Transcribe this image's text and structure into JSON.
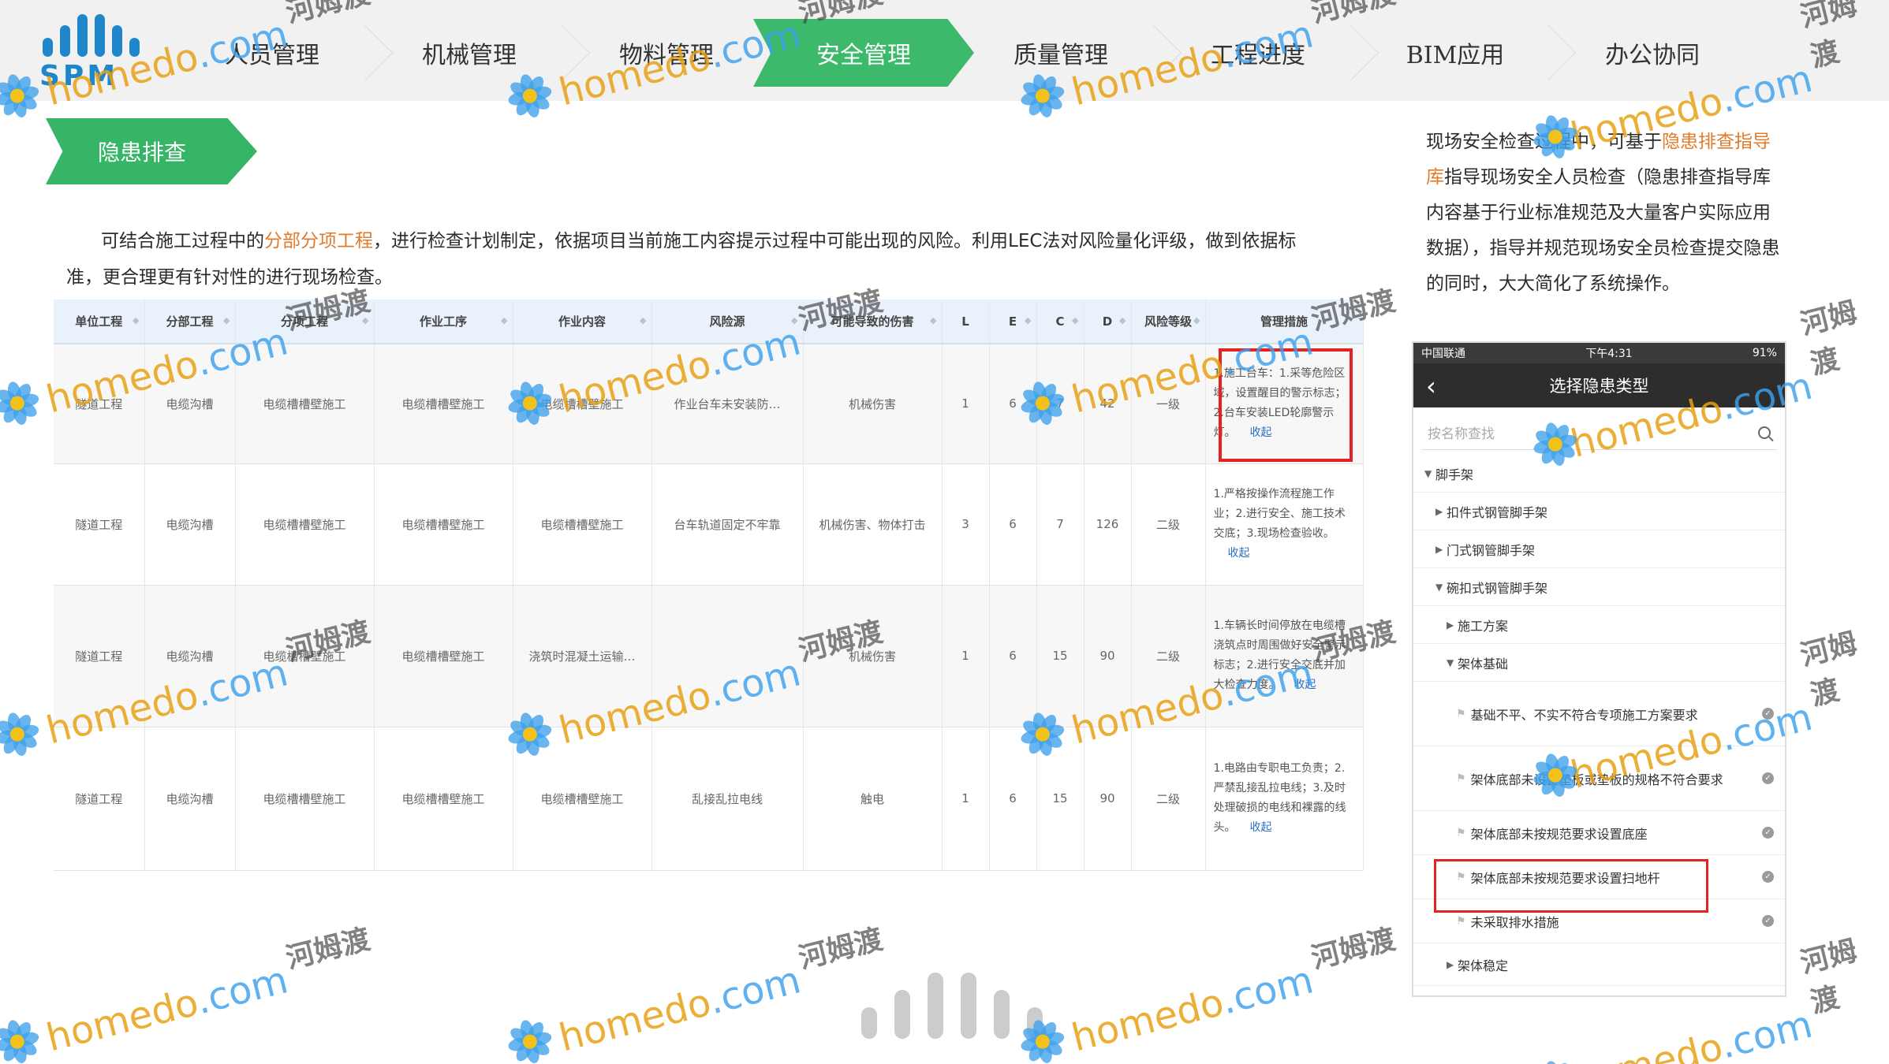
{
  "brand": {
    "logo_text": "SPM"
  },
  "nav": {
    "items": [
      {
        "label": "人员管理",
        "active": false
      },
      {
        "label": "机械管理",
        "active": false
      },
      {
        "label": "物料管理",
        "active": false
      },
      {
        "label": "安全管理",
        "active": true
      },
      {
        "label": "质量管理",
        "active": false
      },
      {
        "label": "工程进度",
        "active": false
      },
      {
        "label": "BIM应用",
        "active": false
      },
      {
        "label": "办公协同",
        "active": false
      }
    ],
    "active_color": "#3cb96a"
  },
  "section": {
    "title": "隐患排查"
  },
  "description": {
    "part1": "可结合施工过程中的",
    "highlight": "分部分项工程",
    "part2": "，进行检查计划制定，依据项目当前施工内容提示过程中可能出现的风险。利用LEC法对风险量化评级，做到依据标准，更合理更有针对性的进行现场检查。"
  },
  "table": {
    "columns": [
      "单位工程",
      "分部工程",
      "分项工程",
      "作业工序",
      "作业内容",
      "风险源",
      "可能导致的伤害",
      "L",
      "E",
      "C",
      "D",
      "风险等级",
      "管理措施"
    ],
    "collapse_label": "收起",
    "rows": [
      {
        "unit": "隧道工程",
        "part": "电缆沟槽",
        "item": "电缆槽槽壁施工",
        "process": "电缆槽槽壁施工",
        "content": "电缆槽槽壁施工",
        "risk": "作业台车未安装防…",
        "harm": "机械伤害",
        "L": "1",
        "E": "6",
        "C": "7",
        "D": "42",
        "level": "一级",
        "measure": "1.施工台车：1.采等危险区域，设置醒目的警示标志；2.台车安装LED轮廓警示灯。"
      },
      {
        "unit": "隧道工程",
        "part": "电缆沟槽",
        "item": "电缆槽槽壁施工",
        "process": "电缆槽槽壁施工",
        "content": "电缆槽槽壁施工",
        "risk": "台车轨道固定不牢靠",
        "harm": "机械伤害、物体打击",
        "L": "3",
        "E": "6",
        "C": "7",
        "D": "126",
        "level": "二级",
        "measure": "1.严格按操作流程施工作业；2.进行安全、施工技术交底；3.现场检查验收。"
      },
      {
        "unit": "隧道工程",
        "part": "电缆沟槽",
        "item": "电缆槽槽壁施工",
        "process": "电缆槽槽壁施工",
        "content": "浇筑时混凝土运输…",
        "risk": "",
        "harm": "机械伤害",
        "L": "1",
        "E": "6",
        "C": "15",
        "D": "90",
        "level": "二级",
        "measure": "1.车辆长时间停放在电缆槽浇筑点时周围做好安全警示标志；2.进行安全交底并加大检查力度。"
      },
      {
        "unit": "隧道工程",
        "part": "电缆沟槽",
        "item": "电缆槽槽壁施工",
        "process": "电缆槽槽壁施工",
        "content": "电缆槽槽壁施工",
        "risk": "乱接乱拉电线",
        "harm": "触电",
        "L": "1",
        "E": "6",
        "C": "15",
        "D": "90",
        "level": "二级",
        "measure": "1.电路由专职电工负责；2.严禁乱接乱拉电线；3.及时处理破损的电线和裸露的线头。"
      }
    ]
  },
  "right_text": {
    "part1": "现场安全检查过程中，可基于",
    "highlight": "隐患排查指导库",
    "part2": "指导现场安全人员检查（隐患排查指导库内容基于行业标准规范及大量客户实际应用数据），指导并规范现场安全员检查提交隐患的同时，大大简化了系统操作。"
  },
  "phone": {
    "carrier": "中国联通",
    "time": "下午4:31",
    "battery": "91%",
    "title": "选择隐患类型",
    "search_placeholder": "按名称查找",
    "tree": [
      {
        "label": "脚手架",
        "arrow": "▼"
      },
      {
        "label": "扣件式钢管脚手架",
        "arrow": "▶"
      },
      {
        "label": "门式钢管脚手架",
        "arrow": "▶"
      },
      {
        "label": "碗扣式钢管脚手架",
        "arrow": "▼"
      },
      {
        "label": "施工方案",
        "arrow": "▶"
      },
      {
        "label": "架体基础",
        "arrow": "▼"
      },
      {
        "label": "基础不平、不实不符合专项施工方案要求"
      },
      {
        "label": "架体底部未设置垫板或垫板的规格不符合要求"
      },
      {
        "label": "架体底部未按规范要求设置底座"
      },
      {
        "label": "架体底部未按规范要求设置扫地杆"
      },
      {
        "label": "未采取排水措施"
      },
      {
        "label": "架体稳定",
        "arrow": "▶"
      }
    ]
  },
  "watermark": {
    "brand": "homedo",
    "domain": ".com",
    "cn": "河姆渡"
  }
}
